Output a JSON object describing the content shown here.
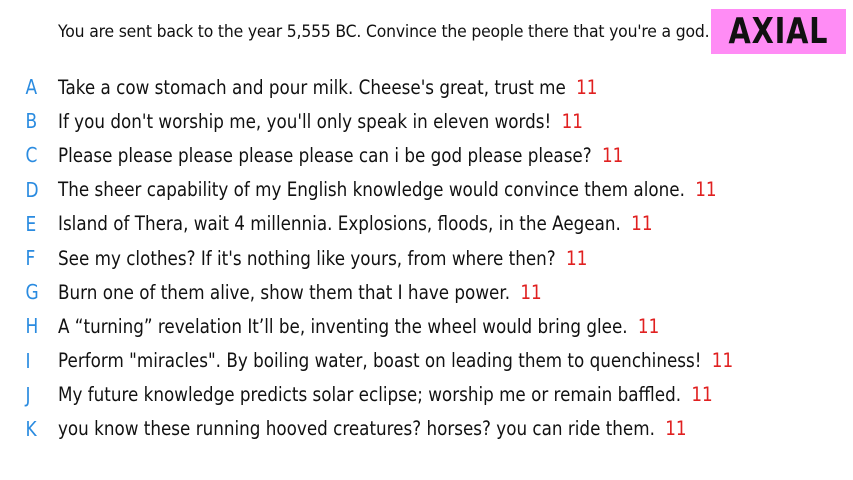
{
  "prompt": "You are sent back to the year 5,555 BC. Convince the people there that you're a god.",
  "badge": "AXIAL",
  "colors": {
    "letter": "#2a8be0",
    "count": "#e02020",
    "badge_bg": "#ff8cf5"
  },
  "answers": [
    {
      "letter": "A",
      "text": "Take a cow stomach and pour milk. Cheese's great, trust me",
      "count": "11"
    },
    {
      "letter": "B",
      "text": "If you don't worship me, you'll only speak in eleven words!",
      "count": "11"
    },
    {
      "letter": "C",
      "text": "Please please please please please can i be god please please?",
      "count": "11"
    },
    {
      "letter": "D",
      "text": "The sheer capability of my English knowledge would convince them alone.",
      "count": "11"
    },
    {
      "letter": "E",
      "text": "Island of Thera, wait 4 millennia. Explosions, floods, in the Aegean.",
      "count": "11"
    },
    {
      "letter": "F",
      "text": "See my clothes? If it's nothing like yours, from where then?",
      "count": "11"
    },
    {
      "letter": "G",
      "text": "Burn one of them alive, show them that I have power.",
      "count": "11"
    },
    {
      "letter": "H",
      "text": "A “turning” revelation It’ll be, inventing the wheel would bring glee.",
      "count": "11"
    },
    {
      "letter": "I",
      "text": "Perform \"miracles\". By boiling water, boast on leading them to quenchiness!",
      "count": "11"
    },
    {
      "letter": "J",
      "text": "My future knowledge predicts solar eclipse; worship me or remain baffled.",
      "count": "11"
    },
    {
      "letter": "K",
      "text": "you know these running hooved creatures? horses? you can ride them.",
      "count": "11"
    }
  ]
}
